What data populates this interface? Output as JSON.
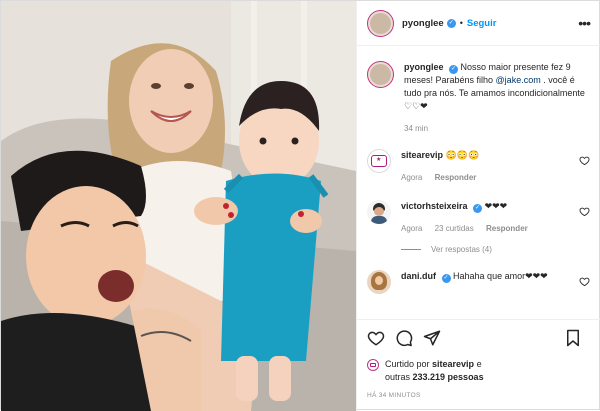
{
  "header": {
    "username": "pyonglee",
    "separator": "•",
    "follow_label": "Seguir",
    "more_icon": "more-horizontal-icon"
  },
  "caption": {
    "username": "pyonglee",
    "text_before_link": "Nosso maior presente fez 9 meses! Parabéns filho ",
    "link_text": "@jake.com",
    "text_after_link": " . você é tudo pra nós. Te amamos incondicionalmente ♡♡❤",
    "time": "34 min"
  },
  "comments": [
    {
      "username": "sitearevip",
      "text": "😳😳😳",
      "time": "Agora",
      "likes": "",
      "reply_label": "Responder"
    },
    {
      "username": "victorhsteixeira",
      "verified": true,
      "text": "❤❤❤",
      "time": "Agora",
      "likes": "23 curtidas",
      "reply_label": "Responder",
      "view_replies": "Ver respostas (4)"
    },
    {
      "username": "dani.duf",
      "verified": true,
      "text": "Hahaha que amor❤❤❤",
      "time": "",
      "likes": "",
      "reply_label": ""
    }
  ],
  "actions": {
    "liked_by_prefix": "Curtido por ",
    "liked_by_user": "sitearevip",
    "liked_by_suffix": " e",
    "others_prefix": "outras ",
    "others_count": "233.219 pessoas",
    "posted_ago": "HÁ 34 MINUTOS"
  },
  "colors": {
    "accent": "#0095f6",
    "verified": "#3897f0",
    "story_ring": "#c13584",
    "muted": "#8e8e8e"
  }
}
